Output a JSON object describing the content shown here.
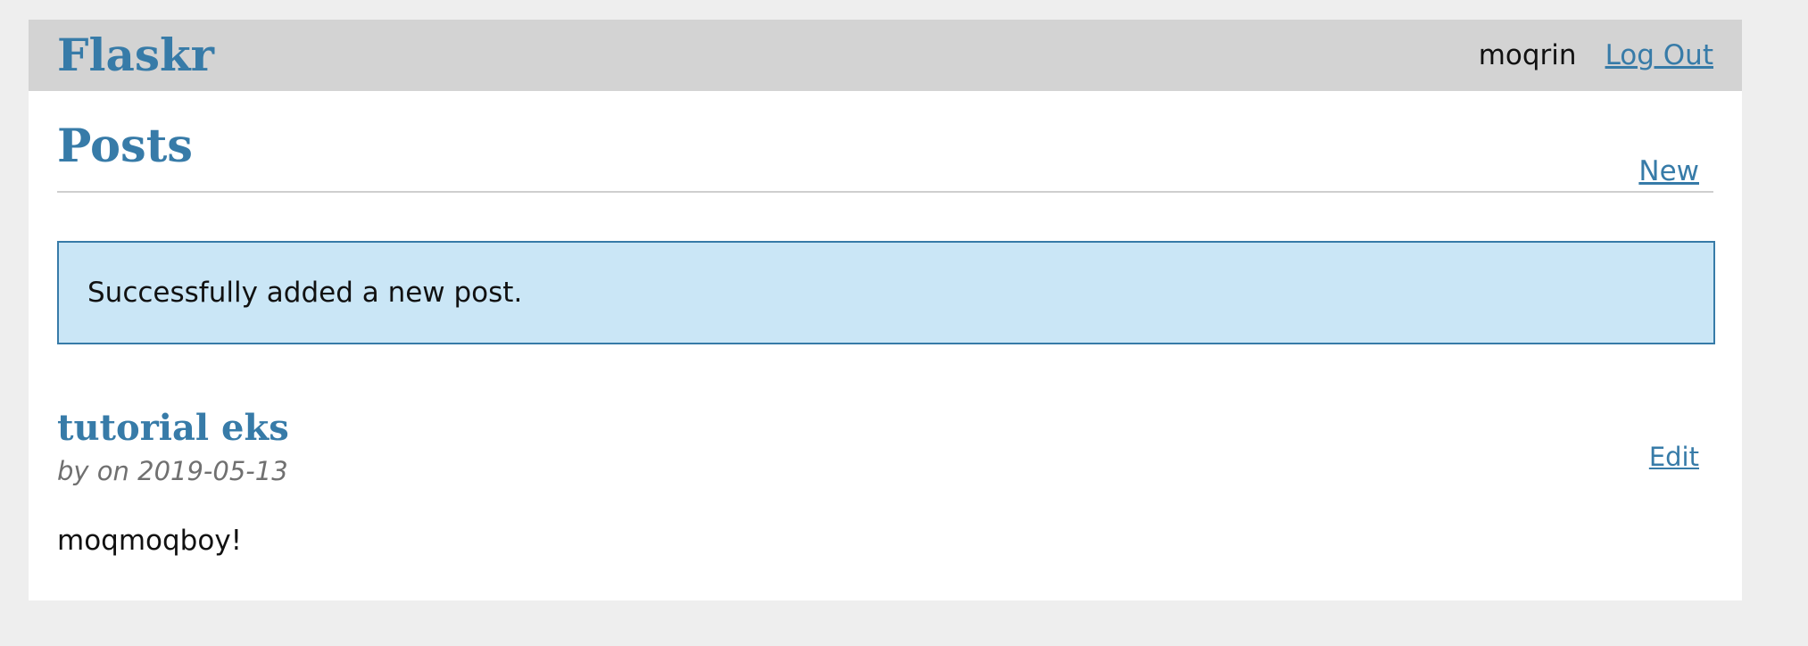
{
  "nav": {
    "brand": "Flaskr",
    "username": "moqrin",
    "logout_label": "Log Out"
  },
  "header": {
    "title": "Posts",
    "new_label": "New"
  },
  "flash": {
    "message": "Successfully added a new post."
  },
  "posts": [
    {
      "title": "tutorial eks",
      "meta": "by on 2019-05-13",
      "edit_label": "Edit",
      "body": "moqmoqboy!"
    }
  ],
  "colors": {
    "accent": "#377ba8",
    "nav_background": "#d3d3d3",
    "flash_background": "#cae6f6",
    "page_background": "#eeeeee"
  }
}
